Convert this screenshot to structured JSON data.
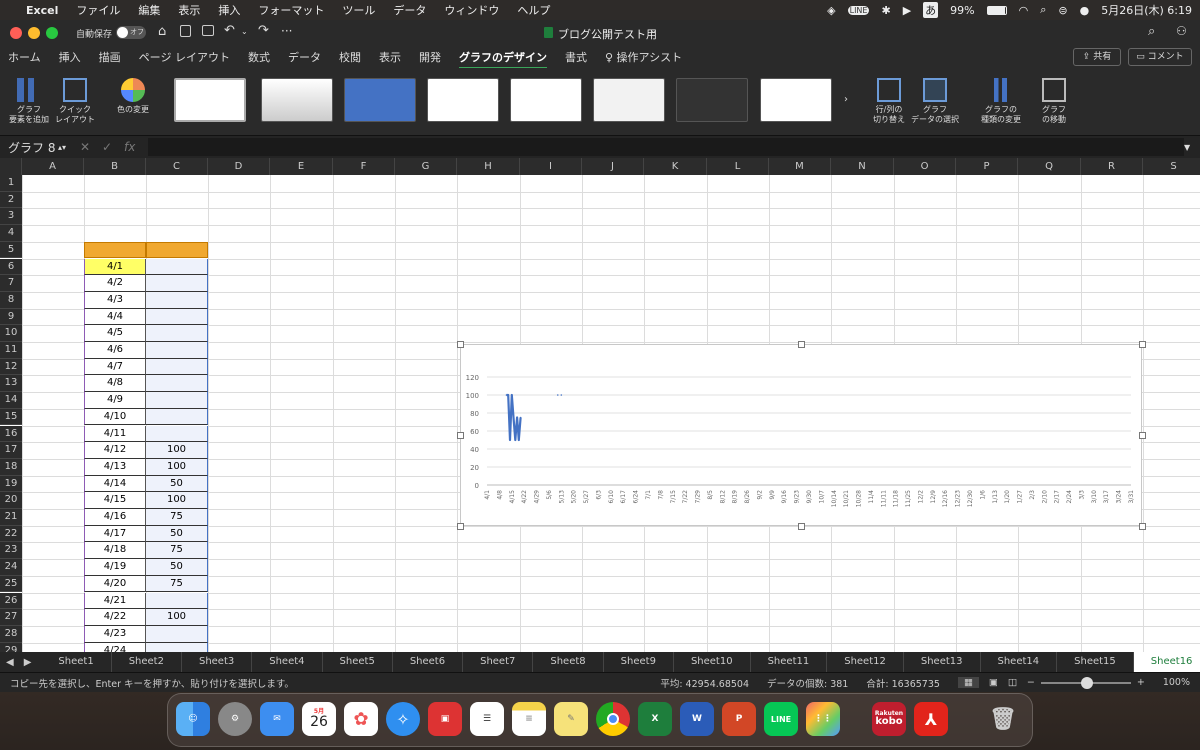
{
  "menubar": {
    "apple": "",
    "app": "Excel",
    "items": [
      "ファイル",
      "編集",
      "表示",
      "挿入",
      "フォーマット",
      "ツール",
      "データ",
      "ウィンドウ",
      "ヘルプ"
    ],
    "battery": "99%",
    "ime": "あ",
    "datetime": "5月26日(木)  6:19"
  },
  "titlebar": {
    "autosave_label": "自動保存",
    "autosave_state": "オフ",
    "title": "ブログ公開テスト用"
  },
  "ribbon_tabs": [
    "ホーム",
    "挿入",
    "描画",
    "ページ レイアウト",
    "数式",
    "データ",
    "校閲",
    "表示",
    "開発",
    "グラフのデザイン",
    "書式",
    "操作アシスト"
  ],
  "share": {
    "share_label": "共有",
    "comment_label": "コメント"
  },
  "ribbon": {
    "add_element": "グラフ\n要素を追加",
    "quick_layout": "クイック\nレイアウト",
    "change_color": "色の変更",
    "switch_row_col": "行/列の\n切り替え",
    "select_data": "グラフ\nデータの選択",
    "change_type": "グラフの\n種類の変更",
    "move_chart": "グラフ\nの移動"
  },
  "formula_bar": {
    "name_box": "グラフ 8",
    "fx": "fx",
    "value": ""
  },
  "columns": [
    "A",
    "B",
    "C",
    "D",
    "E",
    "F",
    "G",
    "H",
    "I",
    "J",
    "K",
    "L",
    "M",
    "N",
    "O",
    "P",
    "Q",
    "R",
    "S"
  ],
  "rows": [
    "1",
    "2",
    "3",
    "4",
    "5",
    "6",
    "7",
    "8",
    "9",
    "10",
    "11",
    "12",
    "13",
    "14",
    "15",
    "16",
    "17",
    "18",
    "19",
    "20",
    "21",
    "22",
    "23",
    "24",
    "25",
    "26",
    "27",
    "28",
    "29"
  ],
  "data_rows": [
    {
      "date": "4/1",
      "value": ""
    },
    {
      "date": "4/2",
      "value": ""
    },
    {
      "date": "4/3",
      "value": ""
    },
    {
      "date": "4/4",
      "value": ""
    },
    {
      "date": "4/5",
      "value": ""
    },
    {
      "date": "4/6",
      "value": ""
    },
    {
      "date": "4/7",
      "value": ""
    },
    {
      "date": "4/8",
      "value": ""
    },
    {
      "date": "4/9",
      "value": ""
    },
    {
      "date": "4/10",
      "value": ""
    },
    {
      "date": "4/11",
      "value": ""
    },
    {
      "date": "4/12",
      "value": "100"
    },
    {
      "date": "4/13",
      "value": "100"
    },
    {
      "date": "4/14",
      "value": "50"
    },
    {
      "date": "4/15",
      "value": "100"
    },
    {
      "date": "4/16",
      "value": "75"
    },
    {
      "date": "4/17",
      "value": "50"
    },
    {
      "date": "4/18",
      "value": "75"
    },
    {
      "date": "4/19",
      "value": "50"
    },
    {
      "date": "4/20",
      "value": "75"
    },
    {
      "date": "4/21",
      "value": ""
    },
    {
      "date": "4/22",
      "value": "100"
    },
    {
      "date": "4/23",
      "value": ""
    },
    {
      "date": "4/24",
      "value": ""
    }
  ],
  "chart_data": {
    "type": "line",
    "title": "",
    "xlabel": "",
    "ylabel": "",
    "ylim": [
      0,
      120
    ],
    "yticks": [
      "0",
      "20",
      "40",
      "60",
      "80",
      "100",
      "120"
    ],
    "x_ticks": [
      "4/1",
      "4/8",
      "4/15",
      "4/22",
      "4/29",
      "5/6",
      "5/13",
      "5/20",
      "5/27",
      "6/3",
      "6/10",
      "6/17",
      "6/24",
      "7/1",
      "7/8",
      "7/15",
      "7/22",
      "7/29",
      "8/5",
      "8/12",
      "8/19",
      "8/26",
      "9/2",
      "9/9",
      "9/16",
      "9/23",
      "9/30",
      "10/7",
      "10/14",
      "10/21",
      "10/28",
      "11/4",
      "11/11",
      "11/18",
      "11/25",
      "12/2",
      "12/9",
      "12/16",
      "12/23",
      "12/30",
      "1/6",
      "1/13",
      "1/20",
      "1/27",
      "2/3",
      "2/10",
      "2/17",
      "2/24",
      "3/3",
      "3/10",
      "3/17",
      "3/24",
      "3/31"
    ],
    "x_range": [
      "4/1",
      "3/31"
    ],
    "grid": true,
    "legend": "none",
    "points": [
      {
        "x": "4/12",
        "y": 100
      },
      {
        "x": "4/13",
        "y": 100
      },
      {
        "x": "4/14",
        "y": 50
      },
      {
        "x": "4/15",
        "y": 100
      },
      {
        "x": "4/16",
        "y": 75
      },
      {
        "x": "4/17",
        "y": 50
      },
      {
        "x": "4/18",
        "y": 75
      },
      {
        "x": "4/19",
        "y": 50
      },
      {
        "x": "4/20",
        "y": 75
      },
      {
        "x": "5/11",
        "y": 100
      },
      {
        "x": "5/13",
        "y": 100
      }
    ],
    "series_color": "#4472c4"
  },
  "sheets": [
    "Sheet1",
    "Sheet2",
    "Sheet3",
    "Sheet4",
    "Sheet5",
    "Sheet6",
    "Sheet7",
    "Sheet8",
    "Sheet9",
    "Sheet10",
    "Sheet11",
    "Sheet12",
    "Sheet13",
    "Sheet14",
    "Sheet15",
    "Sheet16"
  ],
  "active_sheet": "Sheet16",
  "status": {
    "message": "コピー先を選択し、Enter キーを押すか、貼り付けを選択します。",
    "average": "平均: 42954.68504",
    "count": "データの個数: 381",
    "sum": "合計: 16365735",
    "zoom": "100%"
  },
  "dock": {
    "calendar_month": "5月",
    "calendar_day": "26",
    "kobo_brand": "Rakuten",
    "kobo_name": "kobo"
  },
  "colors": {
    "accent_green": "#1e7e3c",
    "selection_orange": "#f0a830",
    "highlight_yellow": "#ffff66"
  }
}
